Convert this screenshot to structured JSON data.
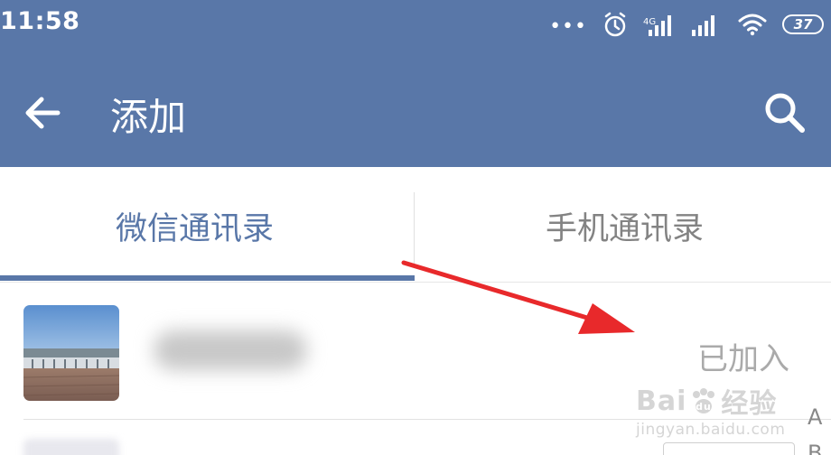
{
  "status_bar": {
    "time": "11:58",
    "dots": "•••",
    "battery": "37",
    "icons": [
      "alarm-icon",
      "signal-icon",
      "signal-icon",
      "wifi-icon",
      "battery-icon"
    ]
  },
  "header": {
    "title": "添加",
    "back_icon": "back-arrow-icon",
    "search_icon": "search-icon"
  },
  "tabs": [
    {
      "label": "微信通讯录",
      "active": true
    },
    {
      "label": "手机通讯录",
      "active": false
    }
  ],
  "contacts": [
    {
      "status": "已加入"
    }
  ],
  "index_letters": [
    "A",
    "B"
  ],
  "watermark": {
    "text_left": "Bai",
    "text_right": "经验",
    "url": "jingyan.baidu.com"
  },
  "colors": {
    "primary": "#5977a8",
    "annotation_arrow": "#e8292b",
    "muted_text": "#aaaaaa"
  }
}
